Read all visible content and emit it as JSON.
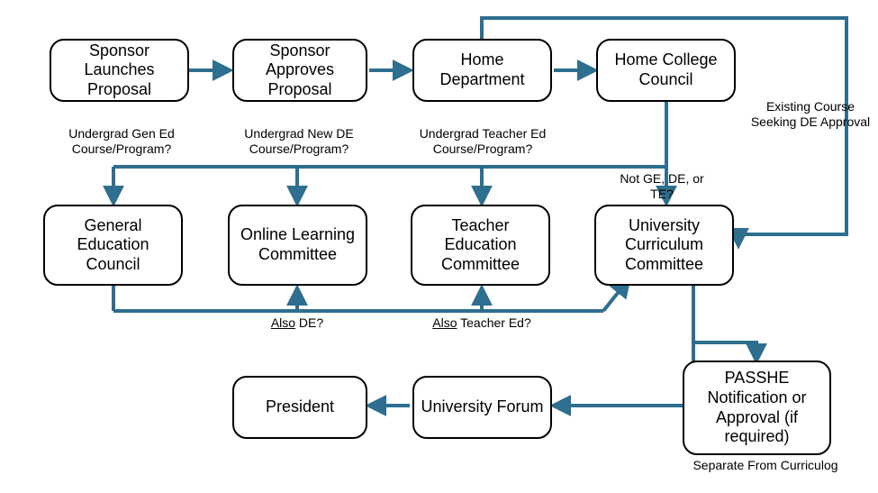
{
  "nodes": {
    "sponsor_launch": "Sponsor Launches Proposal",
    "sponsor_approve": "Sponsor Approves Proposal",
    "home_dept": "Home Department",
    "home_college": "Home College Council",
    "gen_ed": "General Education Council",
    "online_learn": "Online Learning Committee",
    "teacher_ed": "Teacher Education Committee",
    "ucc": "University Curriculum Committee",
    "president": "President",
    "forum": "University Forum",
    "passhe": "PASSHE Notification or Approval (if required)"
  },
  "labels": {
    "ug_gened": "Undergrad Gen Ed Course/Program?",
    "ug_newde": "Undergrad New DE Course/Program?",
    "ug_teached": "Undergrad Teacher Ed Course/Program?",
    "not_gdte": "Not GE, DE, or TE?",
    "also_de_pre": "Also",
    "also_de_post": " DE?",
    "also_te_pre": "Also",
    "also_te_post": " Teacher Ed?",
    "existing_de": "Existing Course Seeking DE Approval",
    "sep_curriculog": "Separate From Curriculog"
  },
  "style": {
    "arrow_color": "#2E6E8E",
    "arrow_w": 4
  }
}
